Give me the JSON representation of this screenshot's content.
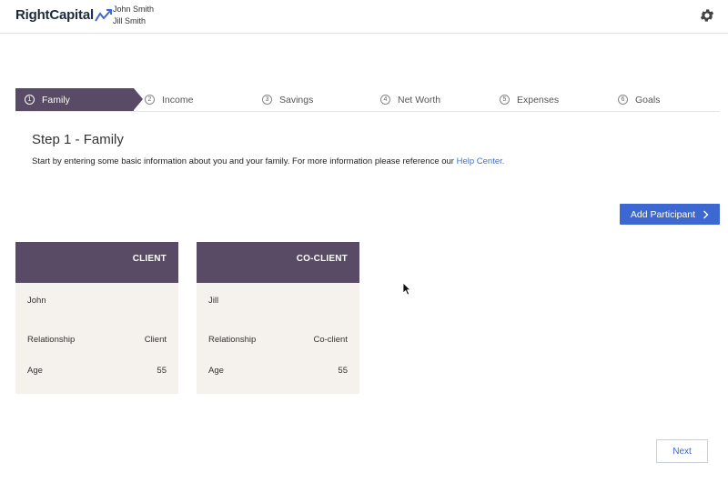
{
  "header": {
    "logo_text": "RightCapital",
    "users": [
      "John Smith",
      "Jill Smith"
    ],
    "settings_icon": "gear-icon"
  },
  "steps": [
    {
      "num": "1",
      "label": "Family",
      "active": true
    },
    {
      "num": "2",
      "label": "Income"
    },
    {
      "num": "3",
      "label": "Savings"
    },
    {
      "num": "4",
      "label": "Net Worth"
    },
    {
      "num": "5",
      "label": "Expenses"
    },
    {
      "num": "6",
      "label": "Goals"
    }
  ],
  "page": {
    "title": "Step 1 - Family",
    "intro": "Start by entering some basic information about you and your family. For more information please reference our ",
    "help_link": "Help Center."
  },
  "add_participant": {
    "label": "Add Participant",
    "icon": "chevron-right-icon"
  },
  "cards": [
    {
      "header": "CLIENT",
      "name": "John",
      "relationship_label": "Relationship",
      "relationship": "Client",
      "age_label": "Age",
      "age": "55"
    },
    {
      "header": "CO-CLIENT",
      "name": "Jill",
      "relationship_label": "Relationship",
      "relationship": "Co-client",
      "age_label": "Age",
      "age": "55"
    }
  ],
  "next_label": "Next",
  "colors": {
    "accent": "#3d67d1",
    "primary": "#594a65",
    "card_bg": "#f5f2ee"
  }
}
